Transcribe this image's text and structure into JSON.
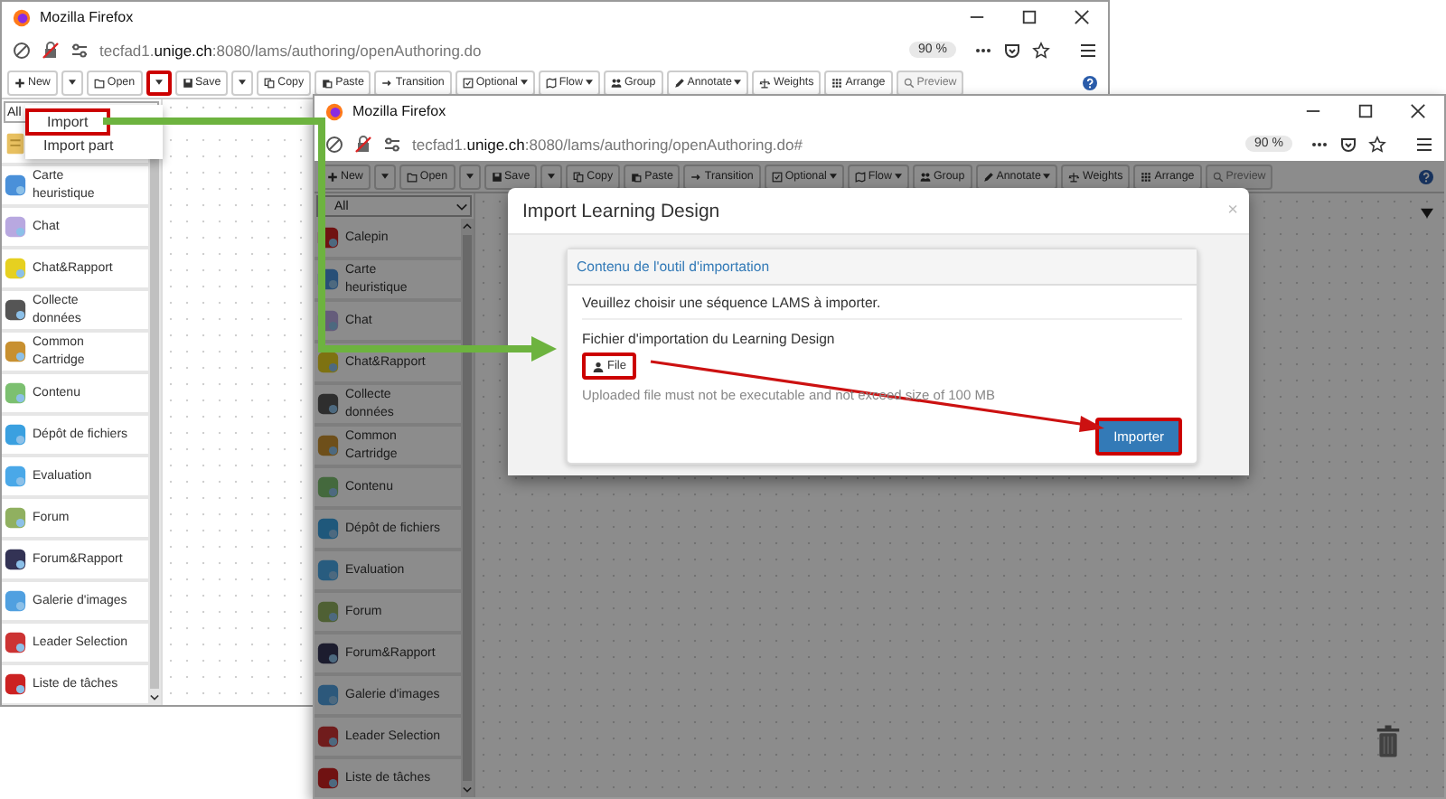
{
  "windows": [
    {
      "title": "Mozilla Firefox",
      "url": {
        "prefix": "tecfad1.",
        "domain": "unige.ch",
        "path": ":8080/lams/authoring/openAuthoring.do"
      },
      "zoom": "90 %",
      "filter": "All",
      "dimmed": false,
      "toolbar": [
        {
          "kind": "button",
          "label": "New",
          "disabled": false,
          "highlighted": false
        },
        {
          "kind": "caret",
          "disabled": false,
          "highlighted": false
        },
        {
          "kind": "button",
          "label": "Open",
          "disabled": false,
          "highlighted": false
        },
        {
          "kind": "caret",
          "disabled": false,
          "highlighted": true
        },
        {
          "kind": "button",
          "label": "Save",
          "disabled": false,
          "highlighted": false
        },
        {
          "kind": "caret",
          "disabled": false,
          "highlighted": false
        },
        {
          "kind": "button",
          "label": "Copy",
          "disabled": false,
          "highlighted": false
        },
        {
          "kind": "button",
          "label": "Paste",
          "disabled": false,
          "highlighted": false
        },
        {
          "kind": "button",
          "label": "Transition",
          "disabled": false,
          "highlighted": false
        },
        {
          "kind": "menu",
          "label": "Optional",
          "disabled": false,
          "highlighted": false
        },
        {
          "kind": "menu",
          "label": "Flow",
          "disabled": false,
          "highlighted": false
        },
        {
          "kind": "button",
          "label": "Group",
          "disabled": false,
          "highlighted": false
        },
        {
          "kind": "menu",
          "label": "Annotate",
          "disabled": false,
          "highlighted": false
        },
        {
          "kind": "button",
          "label": "Weights",
          "disabled": false,
          "highlighted": false
        },
        {
          "kind": "button",
          "label": "Arrange",
          "disabled": false,
          "highlighted": false
        },
        {
          "kind": "button",
          "label": "Preview",
          "disabled": true,
          "highlighted": false
        },
        {
          "kind": "help",
          "disabled": false,
          "highlighted": false
        }
      ],
      "menu": [
        {
          "label": "Import",
          "highlighted": true
        },
        {
          "label": "Import part",
          "highlighted": false
        }
      ],
      "tools": [
        "Carte\nheuristique",
        "Chat",
        "Chat&Rapport",
        "Collecte\ndonnées",
        "Common\nCartridge",
        "Contenu",
        "Dépôt de fichiers",
        "Evaluation",
        "Forum",
        "Forum&Rapport",
        "Galerie d'images",
        "Leader Selection",
        "Liste de tâches"
      ]
    },
    {
      "title": "Mozilla Firefox",
      "url": {
        "prefix": "tecfad1.",
        "domain": "unige.ch",
        "path": ":8080/lams/authoring/openAuthoring.do#"
      },
      "zoom": "90 %",
      "filter": "All",
      "dimmed": true,
      "toolbar": [
        {
          "kind": "button",
          "label": "New",
          "disabled": false,
          "highlighted": false
        },
        {
          "kind": "caret",
          "disabled": false,
          "highlighted": false
        },
        {
          "kind": "button",
          "label": "Open",
          "disabled": false,
          "highlighted": false
        },
        {
          "kind": "caret",
          "disabled": false,
          "highlighted": false
        },
        {
          "kind": "button",
          "label": "Save",
          "disabled": false,
          "highlighted": false
        },
        {
          "kind": "caret",
          "disabled": false,
          "highlighted": false
        },
        {
          "kind": "button",
          "label": "Copy",
          "disabled": false,
          "highlighted": false
        },
        {
          "kind": "button",
          "label": "Paste",
          "disabled": false,
          "highlighted": false
        },
        {
          "kind": "button",
          "label": "Transition",
          "disabled": false,
          "highlighted": false
        },
        {
          "kind": "menu",
          "label": "Optional",
          "disabled": false,
          "highlighted": false
        },
        {
          "kind": "menu",
          "label": "Flow",
          "disabled": false,
          "highlighted": false
        },
        {
          "kind": "button",
          "label": "Group",
          "disabled": false,
          "highlighted": false
        },
        {
          "kind": "menu",
          "label": "Annotate",
          "disabled": false,
          "highlighted": false
        },
        {
          "kind": "button",
          "label": "Weights",
          "disabled": false,
          "highlighted": false
        },
        {
          "kind": "button",
          "label": "Arrange",
          "disabled": false,
          "highlighted": false
        },
        {
          "kind": "button",
          "label": "Preview",
          "disabled": true,
          "highlighted": false
        },
        {
          "kind": "help",
          "disabled": false,
          "highlighted": false
        }
      ],
      "tools": [
        "Calepin",
        "Carte\nheuristique",
        "Chat",
        "Chat&Rapport",
        "Collecte\ndonnées",
        "Common\nCartridge",
        "Contenu",
        "Dépôt de fichiers",
        "Evaluation",
        "Forum",
        "Forum&Rapport",
        "Galerie d'images",
        "Leader Selection",
        "Liste de tâches"
      ],
      "dialog": {
        "title": "Import Learning Design",
        "close": "×",
        "panel_heading": "Contenu de l'outil d'importation",
        "instruction": "Veuillez choisir une séquence LAMS à importer.",
        "field_label": "Fichier d'importation du Learning Design",
        "file_button": {
          "label": "File",
          "highlighted": true
        },
        "hint": "Uploaded file must not be executable and not exceed size of 100 MB",
        "submit_button": {
          "label": "Importer",
          "highlighted": true
        }
      }
    }
  ]
}
